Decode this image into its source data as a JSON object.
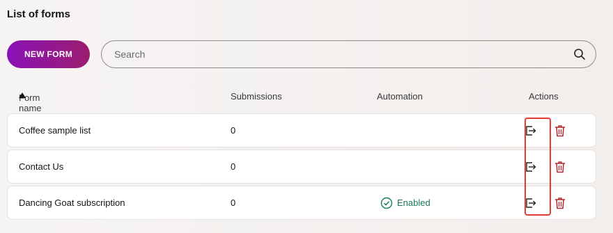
{
  "page": {
    "title": "List of forms"
  },
  "toolbar": {
    "new_form_label": "NEW FORM"
  },
  "search": {
    "placeholder": "Search",
    "value": ""
  },
  "table": {
    "columns": {
      "name": "Form name",
      "submissions": "Submissions",
      "automation": "Automation",
      "actions": "Actions"
    },
    "sort": {
      "column": "name",
      "direction": "ascending"
    },
    "rows": [
      {
        "name": "Coffee sample list",
        "submissions": "0",
        "automation": ""
      },
      {
        "name": "Contact Us",
        "submissions": "0",
        "automation": ""
      },
      {
        "name": "Dancing Goat subscription",
        "submissions": "0",
        "automation": "Enabled"
      }
    ]
  },
  "colors": {
    "brand_start": "#8a12b8",
    "brand_end": "#9b1d6d",
    "enabled": "#147a5e",
    "delete": "#b3262e",
    "highlight": "#e53935"
  },
  "icons": {
    "search": "search-icon",
    "sort": "sort-ascending-icon",
    "open": "open-form-icon",
    "delete": "trash-icon",
    "enabled": "check-circle-icon"
  }
}
